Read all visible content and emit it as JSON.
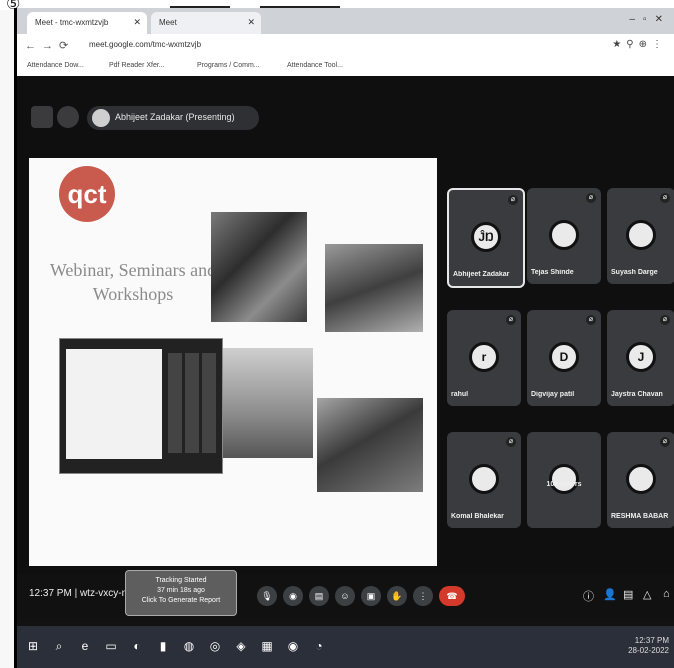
{
  "browser": {
    "tabs": [
      {
        "label": "Meet - tmc-wxmtzvjb"
      },
      {
        "label": "Meet"
      }
    ],
    "url": "meet.google.com/tmc-wxmtzvjb",
    "bookmarks": [
      "Attendance Dow...",
      "Pdf Reader Xfer...",
      "Programs / Comm...",
      "Attendance Tool..."
    ]
  },
  "meet": {
    "presenter_label": "Abhijeet Zadakar (Presenting)",
    "slide_title": "Webinar, Seminars and Workshops",
    "slide_logo": "qct",
    "participants": [
      {
        "name": "Abhijeet Zadakar",
        "initial": "ĴŊ",
        "highlight": true
      },
      {
        "name": "Tejas Shinde",
        "initial": "",
        "highlight": false
      },
      {
        "name": "Suyash Darge",
        "initial": "",
        "highlight": false
      },
      {
        "name": "rahul",
        "initial": "r",
        "highlight": false
      },
      {
        "name": "Digvijay patil",
        "initial": "D",
        "highlight": false
      },
      {
        "name": "Jaystra Chavan",
        "initial": "J",
        "highlight": false
      },
      {
        "name": "Komal Bhalekar",
        "initial": "",
        "highlight": false
      },
      {
        "name": "109 others",
        "initial": "",
        "highlight": false
      },
      {
        "name": "RESHMA BABAR",
        "initial": "",
        "highlight": false
      }
    ],
    "time_label": "12:37 PM | wtz-vxcy-n...",
    "report": {
      "line1": "Tracking Started",
      "line2": "37 min 18s ago",
      "line3": "Click To Generate Report"
    }
  },
  "taskbar": {
    "clock": "12:37 PM",
    "date": "28-02-2022"
  }
}
